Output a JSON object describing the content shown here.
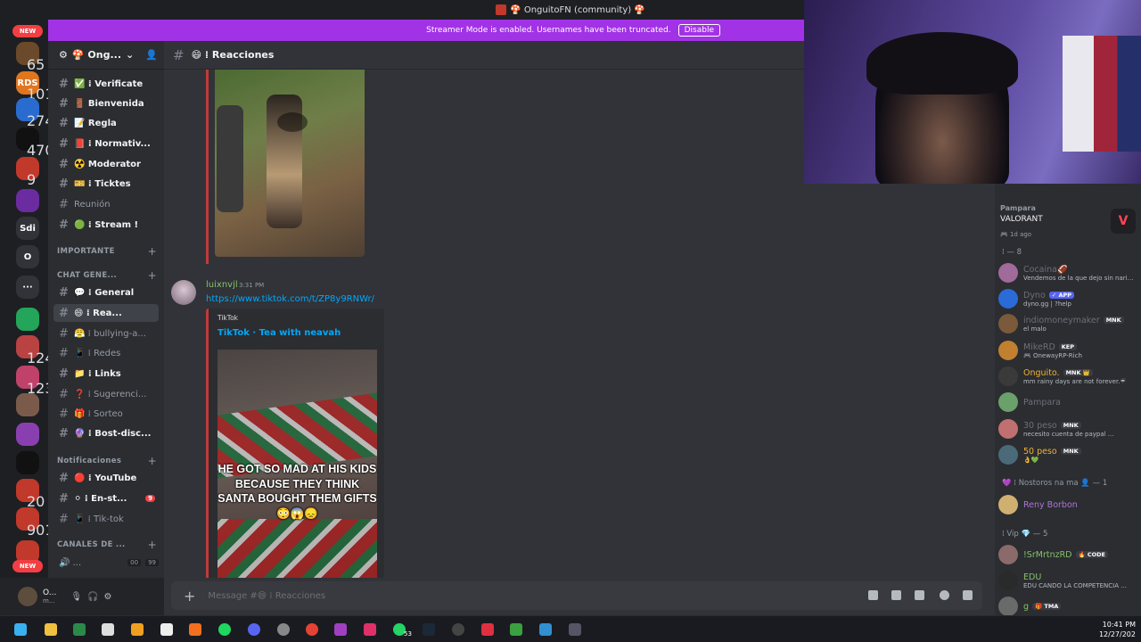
{
  "window": {
    "title": "🍄 OnguitoFN (community) 🍄"
  },
  "banner": {
    "text": "Streamer Mode is enabled. Usernames have been truncated.",
    "button": "Disable"
  },
  "rail": {
    "new_top": "NEW",
    "new_bottom": "NEW",
    "servers": [
      {
        "label": "",
        "badge": "65",
        "color": "#6b4a2b"
      },
      {
        "label": "RDS",
        "badge": "101",
        "color": "#e0761f"
      },
      {
        "label": "",
        "badge": "274",
        "color": "#2a6bd0"
      },
      {
        "label": "",
        "badge": "470",
        "color": "#111111"
      },
      {
        "label": "",
        "badge": "9",
        "color": "#c0392b"
      },
      {
        "label": "",
        "badge": "",
        "color": "#6a2ca0"
      },
      {
        "label": "Sdi",
        "badge": "",
        "color": "#313338"
      },
      {
        "label": "O",
        "badge": "",
        "color": "#313338"
      },
      {
        "label": "···",
        "badge": "",
        "color": "#313338"
      },
      {
        "label": "",
        "badge": "",
        "color": "#23a55a"
      },
      {
        "label": "",
        "badge": "124",
        "color": "#b94242"
      },
      {
        "label": "",
        "badge": "123",
        "color": "#c0426b"
      },
      {
        "label": "",
        "badge": "",
        "color": "#7a5b4b"
      },
      {
        "label": "",
        "badge": "",
        "color": "#8a3fb0"
      },
      {
        "label": "",
        "badge": "",
        "color": "#111111"
      },
      {
        "label": "",
        "badge": "20",
        "color": "#c0392b"
      },
      {
        "label": "",
        "badge": "901",
        "color": "#c0392b"
      },
      {
        "label": "",
        "badge": "",
        "color": "#c0392b"
      }
    ]
  },
  "server": {
    "name": "🍄 Ong..."
  },
  "channels": {
    "top": [
      {
        "name": "✅ ⁞ Verificate",
        "bold": true
      },
      {
        "name": "🚪 Bienvenida",
        "bold": true
      },
      {
        "name": "📝 Regla",
        "bold": true
      },
      {
        "name": "📕 ⁞ Normativ...",
        "bold": true
      },
      {
        "name": "☢️ Moderator",
        "bold": true
      },
      {
        "name": "🎫 ⁞ Ticktes",
        "bold": true
      },
      {
        "name": "Reunión",
        "bold": false
      },
      {
        "name": "🟢 ⁞ Stream !",
        "bold": true
      }
    ],
    "cat_importante": "IMPORTANTE",
    "cat_chat": "CHAT GENE...",
    "chat": [
      {
        "name": "💬 ⁞ General",
        "bold": true
      },
      {
        "name": "😄 ⁞ Rea...",
        "bold": true
      },
      {
        "name": "😤 ⁞ bullying-a...",
        "bold": false
      },
      {
        "name": "📱 ⁞ Redes",
        "bold": false
      },
      {
        "name": "📁 ⁞ Links",
        "bold": true
      },
      {
        "name": "❓ ⁞ Sugerenci...",
        "bold": false
      },
      {
        "name": "🎁 ⁞ Sorteo",
        "bold": false
      },
      {
        "name": "🔮 ⁞ Bost-disc...",
        "bold": true
      }
    ],
    "cat_notif": "Notificaciones",
    "notif": [
      {
        "name": "🔴 ⁞ YouTube",
        "bold": true
      },
      {
        "name": "⚪ ⁞ En-st...",
        "bold": true,
        "badge": "9"
      },
      {
        "name": "📱 ⁞ Tik-tok",
        "bold": false
      }
    ],
    "cat_canales": "CANALES DE ...",
    "voice_item": "🔊 ...",
    "voice_counts": [
      "00",
      "99"
    ]
  },
  "user": {
    "name": "O...",
    "status": "m..."
  },
  "header": {
    "channel": "😄 ⁞ Reacciones"
  },
  "message": {
    "author": "luixnvjl",
    "time": "3:31 PM",
    "link": "https://www.tiktok.com/t/ZP8y9RNWr/",
    "embed_provider": "TikTok",
    "embed_title": "TikTok · Tea with neavah",
    "caption": "HE GOT SO MAD AT HIS KIDS BECAUSE THEY THINK SANTA BOUGHT THEM GIFTS 😳😱😞"
  },
  "composer": {
    "placeholder": "Message #😄 ⁞ Reacciones"
  },
  "members": {
    "activity_user": "Pampara",
    "activity_game": "VALORANT",
    "activity_ago": "🎮 1d ago",
    "role1": "⁞ — 8",
    "list1": [
      {
        "name": "Cocaina🏈",
        "status": "Vendemos de la que dejo sin nariz ...",
        "color": "#6d6f78",
        "tag": "",
        "av": "#a06a9a"
      },
      {
        "name": "Dyno",
        "status": "dyno.gg | ?help",
        "color": "#6d6f78",
        "tag": "✓ APP",
        "av": "#2b6bd8"
      },
      {
        "name": "indiomoneymaker",
        "status": "el malo",
        "color": "#6d6f78",
        "tag": "MNK",
        "av": "#7a5a3a"
      },
      {
        "name": "MikeRD",
        "status": "🎮 OnewayRP-Rich",
        "color": "#6d6f78",
        "tag": "KEP",
        "av": "#c08030"
      },
      {
        "name": "Onguito.",
        "status": "mm rainy days are not forever.☔",
        "color": "#f0b232",
        "tag": "MNK 👑",
        "av": "#3a3a3a"
      },
      {
        "name": "Pampara",
        "status": "",
        "color": "#6d6f78",
        "tag": "",
        "av": "#6aa06a"
      },
      {
        "name": "30 peso",
        "status": "necesito cuenta de paypal ...",
        "color": "#6d6f78",
        "tag": "MNK",
        "av": "#c07070"
      },
      {
        "name": "50 peso",
        "status": "👌💚",
        "color": "#f0b232",
        "tag": "MNK",
        "av": "#4a6a7a"
      }
    ],
    "role2": "💜 ⁞ Nostoros na ma 👤 — 1",
    "list2": [
      {
        "name": "Reny Borbon",
        "status": "",
        "color": "#b173d6",
        "tag": "",
        "av": "#d0b070"
      }
    ],
    "role3": "⁞ Vip 💎 — 5",
    "list3": [
      {
        "name": "!SrMrtnzRD",
        "status": "",
        "color": "#86c16a",
        "tag": "🔥 CODE",
        "av": "#8a6a6a"
      },
      {
        "name": "EDU",
        "status": "EDU CANDO LA COMPETENCIA ...",
        "color": "#86c16a",
        "tag": "",
        "av": "#2a2a2a"
      },
      {
        "name": "g",
        "status": "",
        "color": "#86c16a",
        "tag": "🎁 TMA",
        "av": "#6a6a6a"
      }
    ]
  },
  "taskbar": {
    "time": "10:41 PM",
    "date": "12/27/202",
    "badge": "53"
  }
}
